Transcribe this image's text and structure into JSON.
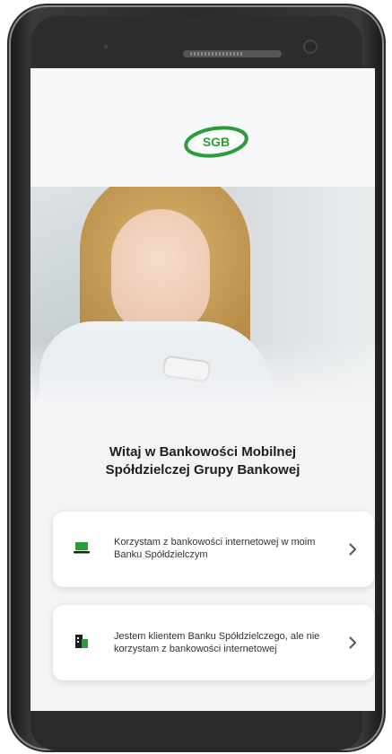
{
  "brand": {
    "logo_text": "SGB",
    "accent": "#2a9d3a"
  },
  "welcome": {
    "line1": "Witaj w Bankowości Mobilnej",
    "line2": "Spółdzielczej Grupy Bankowej"
  },
  "options": [
    {
      "label": "Korzystam z bankowości internetowej w moim Banku Spółdzielczym",
      "icon": "laptop-icon"
    },
    {
      "label": "Jestem klientem Banku Spółdzielczego, ale nie korzystam z bankowości internetowej",
      "icon": "bank-building-icon"
    }
  ]
}
